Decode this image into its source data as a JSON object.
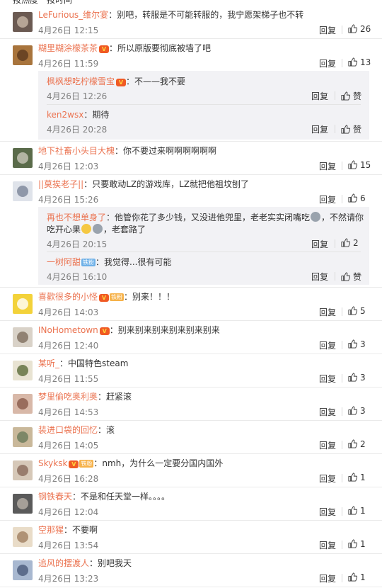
{
  "top": {
    "cut_text": "按热度　按时间"
  },
  "labels": {
    "reply": "回复",
    "zan": "赞"
  },
  "comments": [
    {
      "name": "LeFurious_维尔宴",
      "text": "：别吧，转服是不可能转服的，我宁愿架梯子也不转",
      "time": "4月26日 12:15",
      "likes": "26",
      "avatar_colors": [
        "#6b5a52",
        "#c9b8a8"
      ]
    },
    {
      "name": "糊里糊涂檬茶茶",
      "text": "：所以原版要彻底被墙了吧",
      "time": "4月26日 11:59",
      "likes": "13",
      "avatar_colors": [
        "#a8743c",
        "#5b3a1e"
      ],
      "replies": [
        {
          "name": "枫枫想吃柠檬雪宝",
          "text": "：不——我不要",
          "time": "4月26日 12:26",
          "likes": "赞"
        },
        {
          "name": "ken2wsx",
          "text": "：期待",
          "time": "4月26日 20:28",
          "likes": "赞"
        }
      ]
    },
    {
      "name": "地下社畜小头目大槐",
      "text": "：你不要过来啊啊啊啊啊啊",
      "time": "4月26日 12:03",
      "likes": "15",
      "avatar_colors": [
        "#5a6b4a",
        "#c8c7b8"
      ]
    },
    {
      "name": "||莫挨老子||",
      "text": "：只要敢动LZ的游戏库，LZ就把他祖坟刨了",
      "time": "4月26日 15:26",
      "likes": "6",
      "avatar_colors": [
        "#dfe3ea",
        "#7a8599"
      ],
      "replies": [
        {
          "name": "再也不想单身了",
          "text": "：他管你花了多少钱，又没进他兜里，老老实实闭嘴吃",
          "text_2": "，不然请你",
          "text_line2": "吃开心果",
          "text_line2b": "，老套路了",
          "time": "4月26日 20:15",
          "likes": "2"
        },
        {
          "name": "一树阿甜",
          "badge": "铁粉",
          "text": "：我觉得...很有可能",
          "time": "4月26日 16:10",
          "likes": "赞"
        }
      ]
    },
    {
      "name": "喜歡很多的小怪",
      "badge": "铁粉",
      "text": "：别来！！！",
      "time": "4月26日 14:03",
      "likes": "5",
      "avatar_colors": [
        "#f3d23a",
        "#ffffff"
      ]
    },
    {
      "name": "INoHometown",
      "text": "：别来别来别来别来别来别来",
      "time": "4月26日 12:40",
      "likes": "3",
      "avatar_colors": [
        "#d9d2c8",
        "#7e6e5e"
      ]
    },
    {
      "name": "某听_",
      "text": "：中国特色steam",
      "time": "4月26日 11:55",
      "likes": "3",
      "avatar_colors": [
        "#e8e3d2",
        "#5b6b3a"
      ]
    },
    {
      "name": "梦里偷吃奥利奥",
      "text": "：赶紧滚",
      "time": "4月26日 14:53",
      "likes": "3",
      "avatar_colors": [
        "#d8b8a8",
        "#8a5a4a"
      ]
    },
    {
      "name": "装进口袋的回忆",
      "text": "：滚",
      "time": "4月26日 14:05",
      "likes": "2",
      "avatar_colors": [
        "#c9b89a",
        "#6a7a5a"
      ]
    },
    {
      "name": "Skyksk",
      "badge": "铁粉",
      "text": "：nmh，为什么一定要分国内国外",
      "time": "4月26日 16:28",
      "likes": "1",
      "avatar_colors": [
        "#d6c8b8",
        "#8a6a5a"
      ]
    },
    {
      "name": "钢铁春天",
      "text": "：不是和任天堂一样。。。。",
      "time": "4月26日 12:04",
      "likes": "1",
      "avatar_colors": [
        "#5a5a5a",
        "#b8b0a8"
      ]
    },
    {
      "name": "空那猩",
      "text": "：不要啊",
      "time": "4月26日 13:54",
      "likes": "1",
      "avatar_colors": [
        "#e9dcc8",
        "#a08060"
      ]
    },
    {
      "name": "追风的摆渡人",
      "text": "：别吧我天",
      "time": "4月26日 13:23",
      "likes": "1",
      "avatar_colors": [
        "#a8b8d0",
        "#4a5a7a"
      ]
    }
  ]
}
